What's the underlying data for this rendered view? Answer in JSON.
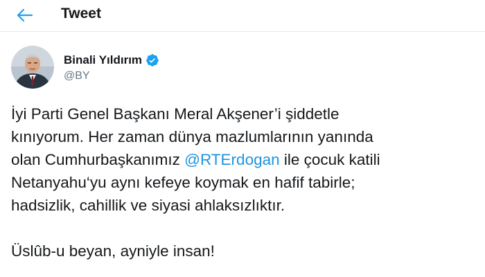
{
  "header": {
    "title": "Tweet",
    "back_icon": "arrow-left-icon",
    "accent": "#1da1f2"
  },
  "author": {
    "display_name": "Binali Yıldırım",
    "handle": "@BY",
    "verified_icon": "verified-badge-icon",
    "verified_color": "#1da1f2"
  },
  "tweet": {
    "line1": "İyi Parti Genel Başkanı Meral Akşener’i şiddetle",
    "line2": "kınıyorum. Her zaman dünya mazlumlarının yanında",
    "line3_before": "olan Cumhurbaşkanımız ",
    "line3_mention": "@RTErdogan",
    "line3_after": " ile çocuk katili",
    "line4": "Netanyahu‘yu aynı kefeye koymak en hafif tabirle;",
    "line5": "hadsizlik, cahillik ve siyasi ahlaksızlıktır.",
    "line6": "Üslûb-u beyan, ayniyle insan!",
    "mention_color": "#1b95e0"
  }
}
